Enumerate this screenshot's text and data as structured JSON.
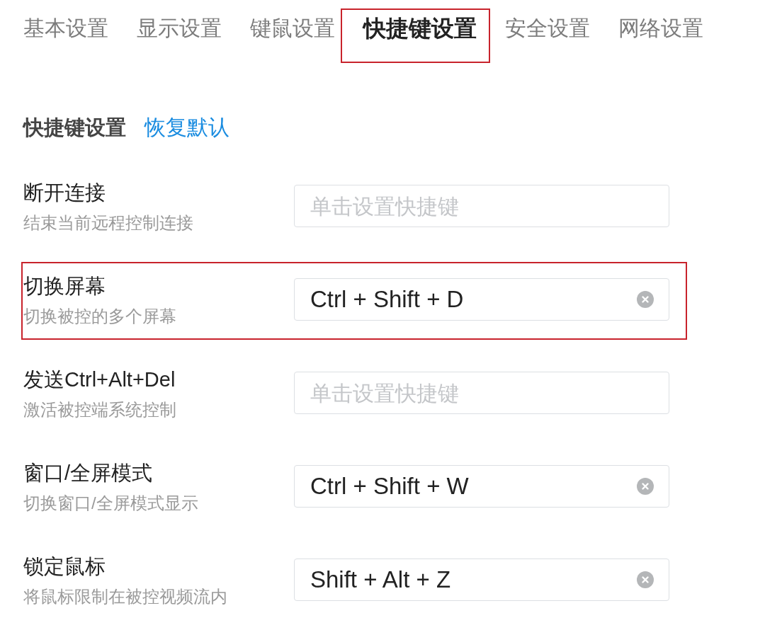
{
  "tabs": [
    {
      "label": "基本设置",
      "selected": false,
      "highlighted": false
    },
    {
      "label": "显示设置",
      "selected": false,
      "highlighted": false
    },
    {
      "label": "键鼠设置",
      "selected": false,
      "highlighted": false
    },
    {
      "label": "快捷键设置",
      "selected": true,
      "highlighted": true
    },
    {
      "label": "安全设置",
      "selected": false,
      "highlighted": false
    },
    {
      "label": "网络设置",
      "selected": false,
      "highlighted": false
    }
  ],
  "section": {
    "title": "快捷键设置",
    "reset_link": "恢复默认"
  },
  "shortcuts": [
    {
      "name": "断开连接",
      "description": "结束当前远程控制连接",
      "placeholder": "单击设置快捷键",
      "highlighted": false
    },
    {
      "name": "切换屏幕",
      "description": "切换被控的多个屏幕",
      "value": "Ctrl + Shift + D",
      "highlighted": true
    },
    {
      "name": "发送Ctrl+Alt+Del",
      "description": "激活被控端系统控制",
      "placeholder": "单击设置快捷键",
      "highlighted": false
    },
    {
      "name": "窗口/全屏模式",
      "description": "切换窗口/全屏模式显示",
      "value": "Ctrl + Shift + W",
      "highlighted": false
    },
    {
      "name": "锁定鼠标",
      "description": "将鼠标限制在被控视频流内",
      "value": "Shift + Alt + Z",
      "highlighted": false
    }
  ]
}
